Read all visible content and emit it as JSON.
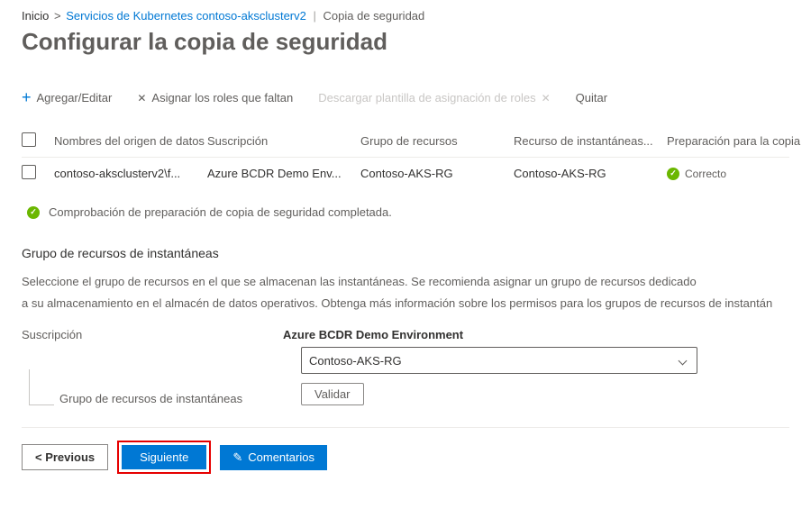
{
  "breadcrumb": {
    "home": "Inicio",
    "service": "Servicios de Kubernetes",
    "cluster": "contoso-aksclusterv2",
    "page": "Copia de seguridad"
  },
  "page_title": "Configurar la copia de seguridad",
  "toolbar": {
    "add_edit": "Agregar/Editar",
    "assign_roles": "Asignar los roles que faltan",
    "download_template": "Descargar plantilla de asignación de roles",
    "remove": "Quitar"
  },
  "table": {
    "headers": {
      "name": "Nombres del origen de datos",
      "subscription": "Suscripción",
      "resource_group": "Grupo de recursos",
      "snapshot_resource": "Recurso de instantáneas...",
      "backup_readiness": "Preparación para la copia"
    },
    "rows": [
      {
        "name": "contoso-aksclusterv2\\f...",
        "subscription": "Azure BCDR Demo Env...",
        "resource_group": "Contoso-AKS-RG",
        "snapshot_resource": "Contoso-AKS-RG",
        "status": "Correcto"
      }
    ]
  },
  "banner": "Comprobación de preparación de copia de seguridad completada.",
  "snapshot_section": {
    "title": "Grupo de recursos de instantáneas",
    "text1": "Seleccione el grupo de recursos en el que se almacenan las instantáneas. Se recomienda asignar un grupo de recursos dedicado",
    "text2": "a su almacenamiento en el almacén de datos operativos. Obtenga más información sobre los permisos para los grupos de recursos de instantán",
    "subscription_label": "Suscripción",
    "subscription_value": "Azure BCDR Demo Environment",
    "rg_label": "Grupo de recursos de instantáneas",
    "rg_value": "Contoso-AKS-RG",
    "validate": "Validar"
  },
  "footer": {
    "previous": "< Previous",
    "next": "Siguiente",
    "feedback": "Comentarios"
  }
}
